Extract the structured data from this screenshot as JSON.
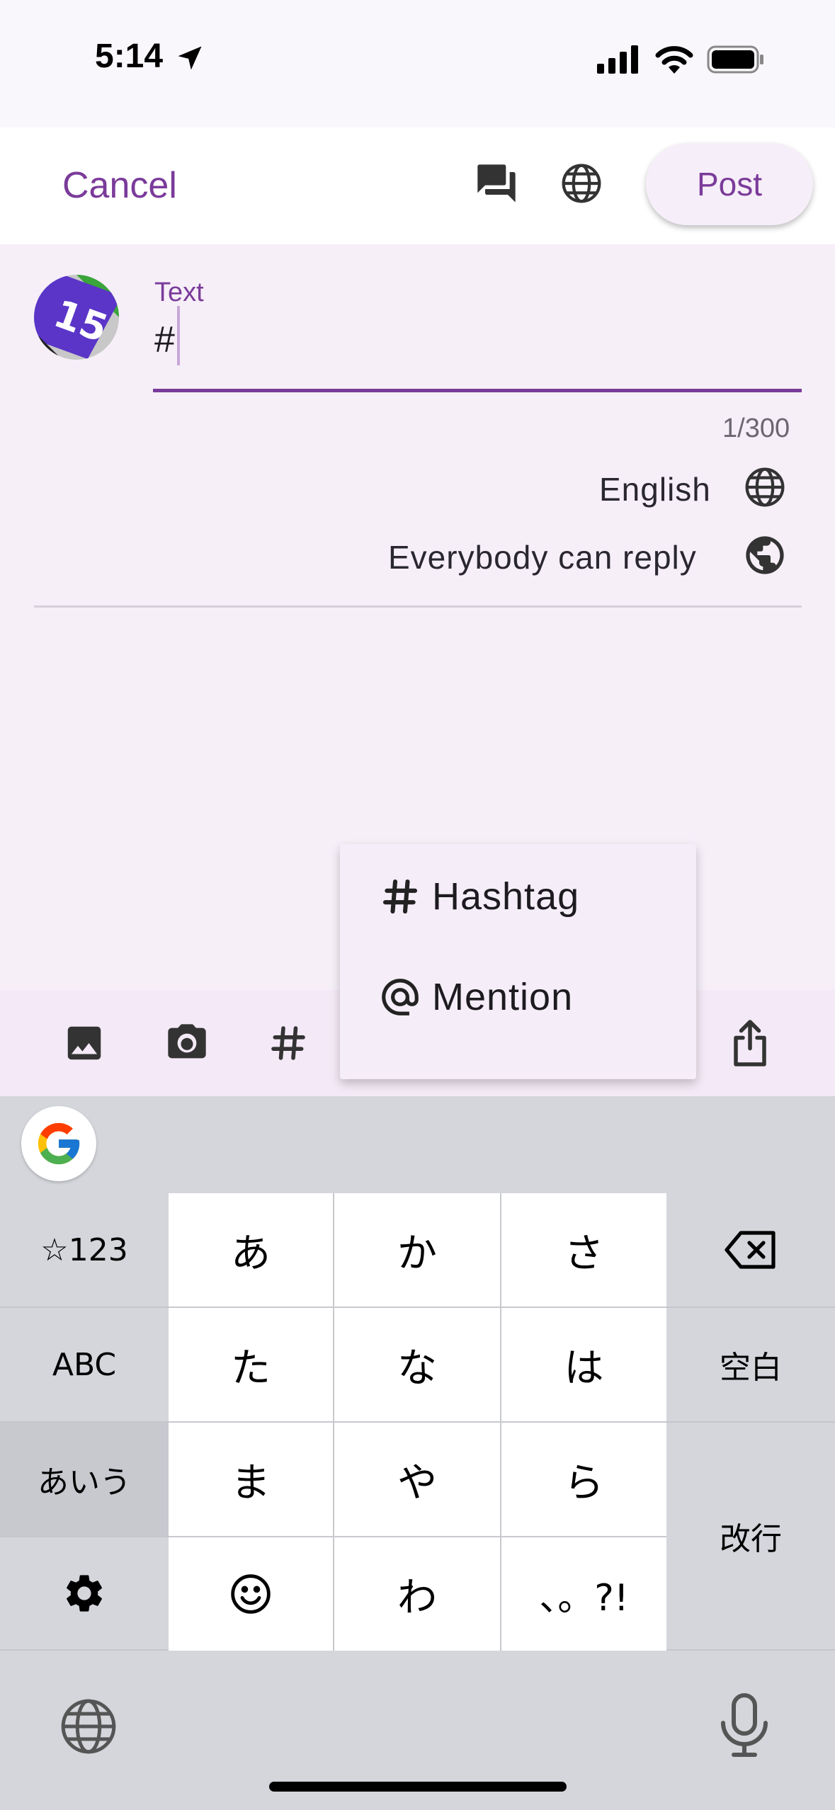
{
  "status_bar": {
    "time": "5:14"
  },
  "header": {
    "cancel_label": "Cancel",
    "post_label": "Post"
  },
  "compose": {
    "field_label": "Text",
    "field_value": "#",
    "counter": "1/300",
    "language": "English",
    "reply_setting": "Everybody can reply"
  },
  "avatar": {
    "badge_number": "15"
  },
  "menu": {
    "items": [
      {
        "label": "Hashtag",
        "icon": "hash-icon"
      },
      {
        "label": "Mention",
        "icon": "at-icon"
      }
    ]
  },
  "toolbar": {
    "icons": [
      "image-icon",
      "camera-icon",
      "hash-icon",
      "share-icon"
    ]
  },
  "keyboard": {
    "left_keys": [
      "☆123",
      "ABC",
      "あいう"
    ],
    "kana_keys": [
      "あ",
      "か",
      "さ",
      "た",
      "な",
      "は",
      "ま",
      "や",
      "ら",
      "わ",
      "、。?!"
    ],
    "space_label": "空白",
    "enter_label": "改行"
  },
  "colors": {
    "accent": "#7a3b9a",
    "compose_bg": "#f6eff8",
    "keyboard_bg": "#d4d6dc"
  }
}
